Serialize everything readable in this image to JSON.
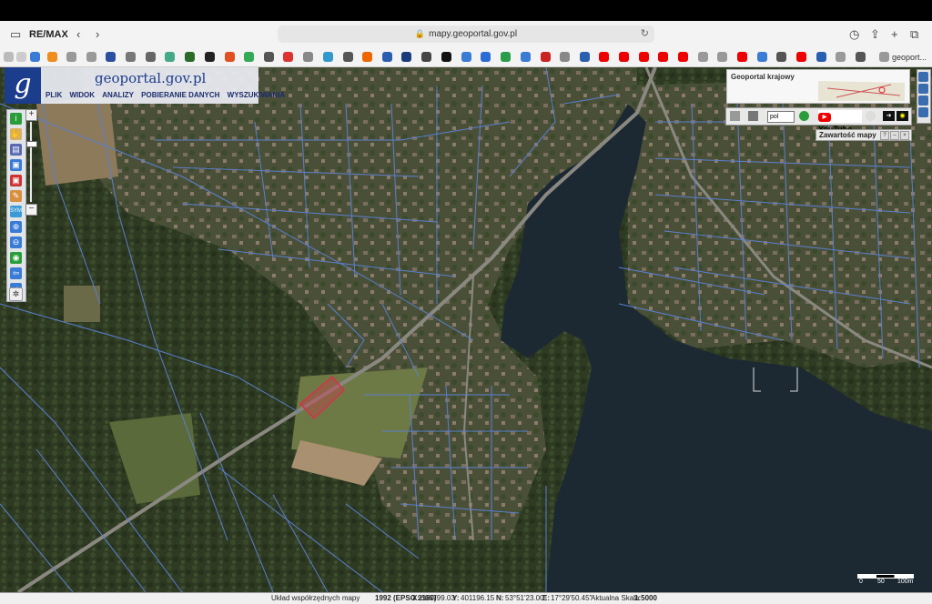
{
  "browser": {
    "profile_label": "RE/MAX",
    "url": "mapy.geoportal.gov.pl",
    "watermark": "RE/MAX",
    "last_favorite_label": "geoport..."
  },
  "geoportal": {
    "logo_letter": "g",
    "logo_text": "geoportal.gov.pl",
    "menu": [
      "PLIK",
      "WIDOK",
      "ANALIZY",
      "POBIERANIE DANYCH",
      "WYSZUKIWANIA"
    ],
    "overview_title": "Geoportal krajowy",
    "language": "pol",
    "youtube_label": "YouTube",
    "contents_label": "Zawartość mapy",
    "scale_labels": [
      "0",
      "50",
      "100m"
    ]
  },
  "status_bar": {
    "system_label": "Układ współrzędnych mapy",
    "system_value": "1992 (EPSG 2180)",
    "x_label": "X:",
    "x_value": "666799.03",
    "y_label": "Y:",
    "y_value": "401196.15",
    "n_label": "N:",
    "n_value": "53°51'23.00\"",
    "e_label": "E:",
    "e_value": "17°29'50.45\"",
    "scale_label": "Aktualna Skala",
    "scale_value": "1:5000"
  },
  "colors": {
    "parcel_lines": "#5b7fd0",
    "lake": "#1a2733",
    "highlight_parcel": "#d5324a",
    "brand_blue": "#1c3c8c"
  }
}
